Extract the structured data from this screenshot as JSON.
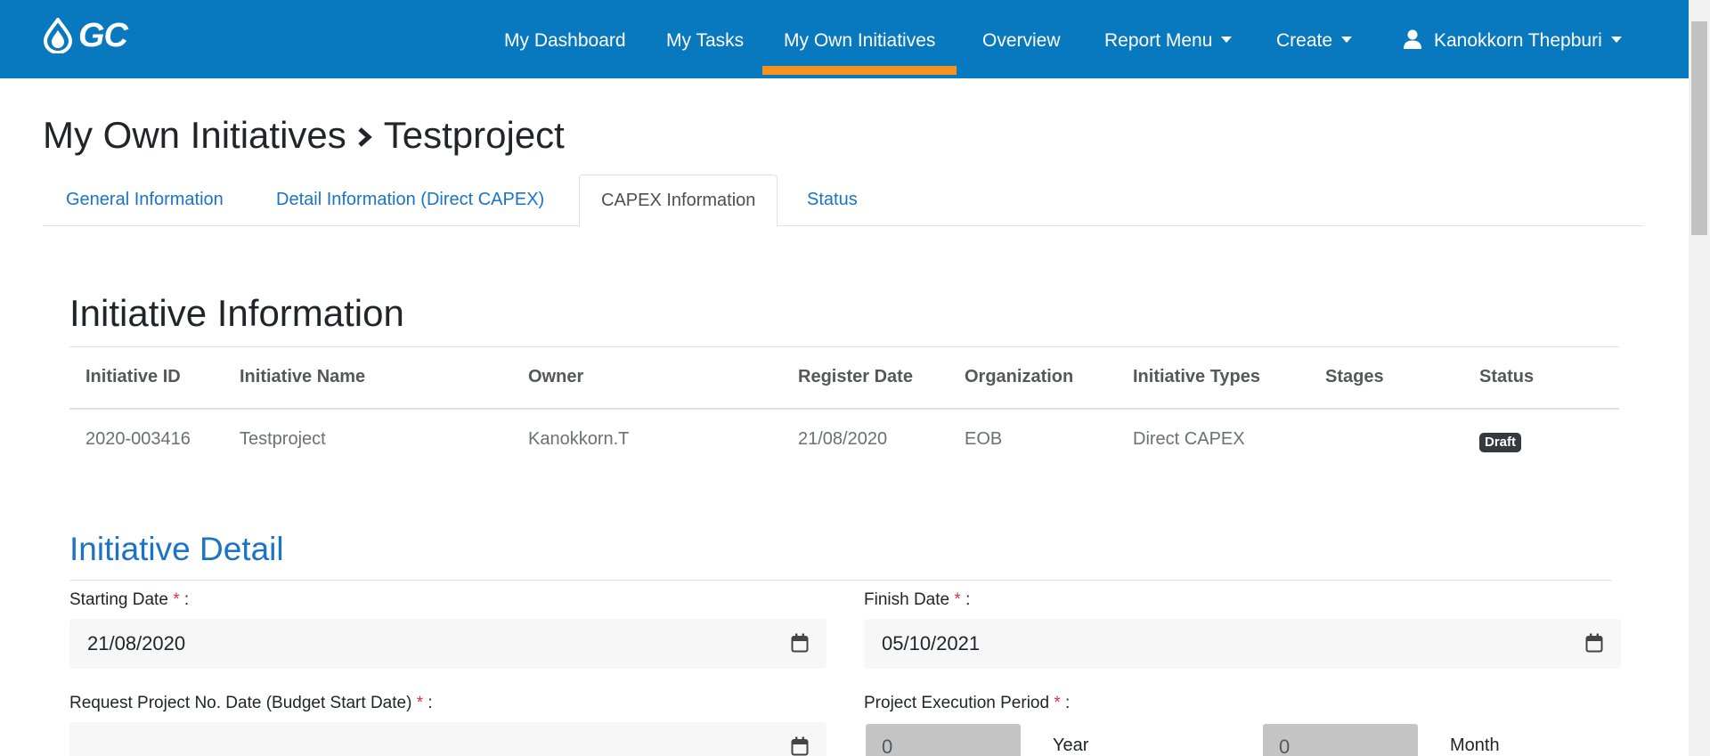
{
  "brand": {
    "logo_text": "GC",
    "color": "#0879bf",
    "accent": "#f7931d"
  },
  "nav": {
    "items": [
      {
        "label": "My Dashboard"
      },
      {
        "label": "My Tasks"
      },
      {
        "label": "My Own Initiatives",
        "active": true
      },
      {
        "label": "Overview"
      },
      {
        "label": "Report Menu",
        "dropdown": true
      },
      {
        "label": "Create",
        "dropdown": true
      }
    ],
    "user": {
      "name": "Kanokkorn Thepburi",
      "icon": "user-icon"
    }
  },
  "breadcrumb": {
    "parent": "My Own Initiatives",
    "current": "Testproject",
    "separator_icon": "chevron-right-icon"
  },
  "tabs": [
    {
      "label": "General Information"
    },
    {
      "label": "Detail Information (Direct CAPEX)"
    },
    {
      "label": "CAPEX Information",
      "active": true
    },
    {
      "label": "Status"
    }
  ],
  "initiative_info": {
    "title": "Initiative Information",
    "columns": [
      "Initiative ID",
      "Initiative Name",
      "Owner",
      "Register Date",
      "Organization",
      "Initiative Types",
      "Stages",
      "Status"
    ],
    "row": {
      "id": "2020-003416",
      "name": "Testproject",
      "owner": "Kanokkorn.T",
      "register_date": "21/08/2020",
      "organization": "EOB",
      "type": "Direct CAPEX",
      "stages": "",
      "status": "Draft"
    }
  },
  "initiative_detail": {
    "title": "Initiative Detail",
    "starting_date": {
      "label": "Starting Date",
      "value": "21/08/2020"
    },
    "finish_date": {
      "label": "Finish Date",
      "value": "05/10/2021"
    },
    "request_date": {
      "label": "Request Project No. Date (Budget Start Date)",
      "value": ""
    },
    "execution_period": {
      "label": "Project Execution Period",
      "year_value": "0",
      "year_unit": "Year",
      "month_value": "0",
      "month_unit": "Month"
    },
    "required_mark": "*",
    "colon": ":"
  }
}
